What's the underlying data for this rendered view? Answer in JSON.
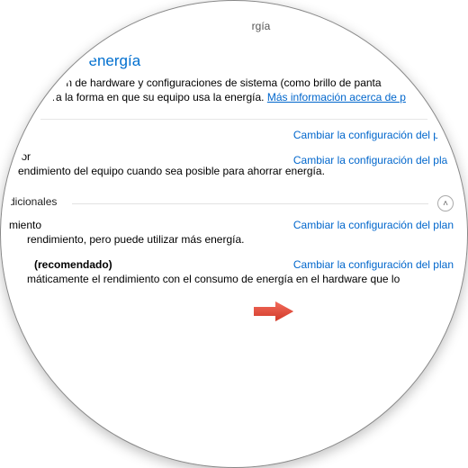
{
  "header_partial": "rgía",
  "section": {
    "title_partial": "plan de energía",
    "desc_line1_partial": "colección de hardware y configuraciones de sistema (como brillo de panta",
    "desc_line2_partial": "ninistra la forma en que su equipo usa la energía.",
    "more_info_link_partial": "Más información acerca de p"
  },
  "change_link": "Cambiar la configuración del plan",
  "plan1": {
    "name_partial": "ador",
    "desc_partial": "l rendimiento del equipo cuando sea posible para ahorrar energía."
  },
  "group_label_partial": "dicionales",
  "plan2": {
    "name_partial": "miento",
    "desc_partial": "rendimiento, pero puede utilizar más energía."
  },
  "plan3": {
    "name_partial": "(recomendado)",
    "desc_partial": "máticamente el rendimiento con el consumo de energía en el hardware que lo"
  }
}
